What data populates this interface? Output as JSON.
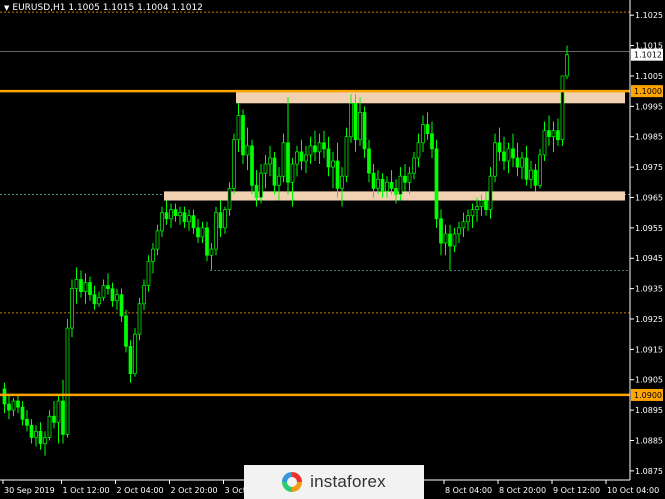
{
  "header": {
    "symbol_line": "EURUSD,H1  1.1005 1.1015 1.1004 1.1012"
  },
  "watermark": {
    "text": "instaforex"
  },
  "colors": {
    "background": "#000000",
    "candle": "#00ff00",
    "level_line": "#ffa500",
    "zone_fill": "#ffdcbd",
    "grid_dotted": "#5f9ea0",
    "grid_orange": "#ffa500",
    "axis_text": "#ffffff"
  },
  "chart_data": {
    "type": "candlestick",
    "symbol": "EURUSD",
    "timeframe": "H1",
    "last_price": 1.1012,
    "ohlc_last": {
      "open": 1.1005,
      "high": 1.1015,
      "low": 1.1004,
      "close": 1.1012
    },
    "ylim": [
      1.0872,
      1.103
    ],
    "y_ticks": [
      1.1025,
      1.1015,
      1.1005,
      1.0995,
      1.0985,
      1.0975,
      1.0965,
      1.0955,
      1.0945,
      1.0935,
      1.0925,
      1.0915,
      1.0905,
      1.0895,
      1.0885,
      1.0875
    ],
    "y_ticks_text": [
      "1.1025",
      "1.1015",
      "1.1005",
      "1.0995",
      "1.0985",
      "1.0975",
      "1.0965",
      "1.0955",
      "1.0945",
      "1.0935",
      "1.0925",
      "1.0915",
      "1.0905",
      "1.0895",
      "1.0885",
      "1.0875"
    ],
    "x_ticks": [
      "30 Sep 2019",
      "1 Oct 12:00",
      "2 Oct 04:00",
      "2 Oct 20:00",
      "3 Oct 12:00",
      "8 Oct 04:00",
      "8 Oct 20:00",
      "9 Oct 12:00",
      "10 Oct 04:00"
    ],
    "x_tick_index": [
      0,
      13,
      25,
      37,
      49,
      98,
      110,
      122,
      134
    ],
    "horizontal_levels": [
      {
        "price": 1.1,
        "label": "1.1000",
        "style": "solid-thick"
      },
      {
        "price": 1.09,
        "label": "1.0900",
        "style": "solid-thick"
      }
    ],
    "zones": [
      {
        "from_index": 52,
        "to_index": 138,
        "low": 1.0996,
        "high": 1.1
      },
      {
        "from_index": 36,
        "to_index": 138,
        "low": 1.0964,
        "high": 1.0967
      }
    ],
    "dotted_lines": [
      {
        "price": 1.1026,
        "color": "orange"
      },
      {
        "price": 1.1013,
        "color": "gray"
      },
      {
        "price": 1.0966,
        "color": "teal"
      },
      {
        "price": 1.0941,
        "color": "teal",
        "from_index": 46
      },
      {
        "price": 1.0927,
        "color": "orange"
      }
    ],
    "candles": [
      [
        1.0902,
        1.0904,
        1.0894,
        1.0897
      ],
      [
        1.0897,
        1.09,
        1.0892,
        1.0895
      ],
      [
        1.0895,
        1.0899,
        1.0893,
        1.0898
      ],
      [
        1.0898,
        1.09,
        1.0894,
        1.0896
      ],
      [
        1.0896,
        1.0898,
        1.089,
        1.0892
      ],
      [
        1.0892,
        1.0895,
        1.0888,
        1.089
      ],
      [
        1.089,
        1.0892,
        1.0884,
        1.0886
      ],
      [
        1.0886,
        1.089,
        1.0883,
        1.0888
      ],
      [
        1.0888,
        1.0891,
        1.0882,
        1.0884
      ],
      [
        1.0884,
        1.0888,
        1.088,
        1.0886
      ],
      [
        1.0886,
        1.0895,
        1.0885,
        1.0893
      ],
      [
        1.0893,
        1.0898,
        1.0889,
        1.0891
      ],
      [
        1.0891,
        1.09,
        1.0884,
        1.0898
      ],
      [
        1.0898,
        1.0905,
        1.0884,
        1.0887
      ],
      [
        1.0887,
        1.0925,
        1.0886,
        1.0922
      ],
      [
        1.0922,
        1.0938,
        1.0919,
        1.0935
      ],
      [
        1.0935,
        1.0942,
        1.093,
        1.0938
      ],
      [
        1.0938,
        1.0941,
        1.0932,
        1.0934
      ],
      [
        1.0934,
        1.094,
        1.093,
        1.0937
      ],
      [
        1.0937,
        1.0939,
        1.0931,
        1.0933
      ],
      [
        1.0933,
        1.0936,
        1.0928,
        1.093
      ],
      [
        1.093,
        1.0934,
        1.0929,
        1.0932
      ],
      [
        1.0932,
        1.0938,
        1.0931,
        1.0936
      ],
      [
        1.0936,
        1.094,
        1.0933,
        1.0935
      ],
      [
        1.0935,
        1.0937,
        1.0929,
        1.0931
      ],
      [
        1.0931,
        1.0935,
        1.0928,
        1.0933
      ],
      [
        1.0933,
        1.0935,
        1.0924,
        1.0926
      ],
      [
        1.0926,
        1.0928,
        1.0914,
        1.0916
      ],
      [
        1.0916,
        1.0918,
        1.0904,
        1.0907
      ],
      [
        1.0907,
        1.0922,
        1.0906,
        1.092
      ],
      [
        1.092,
        1.0932,
        1.0918,
        1.093
      ],
      [
        1.093,
        1.0938,
        1.0928,
        1.0936
      ],
      [
        1.0936,
        1.0946,
        1.0934,
        1.0944
      ],
      [
        1.0944,
        1.095,
        1.094,
        1.0948
      ],
      [
        1.0948,
        1.0956,
        1.0946,
        1.0954
      ],
      [
        1.0954,
        1.0962,
        1.0952,
        1.096
      ],
      [
        1.096,
        1.0964,
        1.0956,
        1.0958
      ],
      [
        1.0958,
        1.0963,
        1.0955,
        1.0961
      ],
      [
        1.0961,
        1.0963,
        1.0957,
        1.0959
      ],
      [
        1.0959,
        1.0962,
        1.0956,
        1.096
      ],
      [
        1.096,
        1.0962,
        1.0955,
        1.0957
      ],
      [
        1.0957,
        1.0961,
        1.0954,
        1.0959
      ],
      [
        1.0959,
        1.0961,
        1.0953,
        1.0955
      ],
      [
        1.0955,
        1.0958,
        1.095,
        1.0952
      ],
      [
        1.0952,
        1.0957,
        1.095,
        1.0955
      ],
      [
        1.0955,
        1.0957,
        1.0944,
        1.0946
      ],
      [
        1.0946,
        1.095,
        1.0941,
        1.0948
      ],
      [
        1.0948,
        1.0962,
        1.0946,
        1.096
      ],
      [
        1.096,
        1.0964,
        1.0952,
        1.0955
      ],
      [
        1.0955,
        1.0962,
        1.0953,
        1.0961
      ],
      [
        1.0961,
        1.097,
        1.0959,
        1.0968
      ],
      [
        1.0968,
        1.0986,
        1.0966,
        1.0984
      ],
      [
        1.0984,
        1.0996,
        1.098,
        1.0992
      ],
      [
        1.0992,
        1.0994,
        1.0976,
        1.0979
      ],
      [
        1.0979,
        1.0988,
        1.0974,
        1.0982
      ],
      [
        1.0982,
        1.0984,
        1.0966,
        1.0969
      ],
      [
        1.0969,
        1.0974,
        1.0962,
        1.0965
      ],
      [
        1.0965,
        1.0976,
        1.0963,
        1.0973
      ],
      [
        1.0973,
        1.0979,
        1.0968,
        1.0976
      ],
      [
        1.0976,
        1.0982,
        1.0972,
        1.0978
      ],
      [
        1.0978,
        1.098,
        1.0966,
        1.0969
      ],
      [
        1.0969,
        1.0975,
        1.0964,
        1.0972
      ],
      [
        1.0972,
        1.0986,
        1.097,
        1.0983
      ],
      [
        1.0983,
        1.0998,
        1.0966,
        1.097
      ],
      [
        1.097,
        1.0978,
        1.0962,
        1.0976
      ],
      [
        1.0976,
        1.0982,
        1.0972,
        1.098
      ],
      [
        1.098,
        1.0984,
        1.0974,
        1.0977
      ],
      [
        1.0977,
        1.0982,
        1.0973,
        1.0979
      ],
      [
        1.0979,
        1.0985,
        1.0976,
        1.0982
      ],
      [
        1.0982,
        1.0987,
        1.0977,
        1.098
      ],
      [
        1.098,
        1.0986,
        1.0976,
        1.0983
      ],
      [
        1.0983,
        1.0987,
        1.0978,
        1.0981
      ],
      [
        1.0981,
        1.0985,
        1.0972,
        1.0975
      ],
      [
        1.0975,
        1.098,
        1.0968,
        1.0977
      ],
      [
        1.0977,
        1.0983,
        1.0965,
        1.0968
      ],
      [
        1.0968,
        1.0975,
        1.0962,
        1.0972
      ],
      [
        1.0972,
        1.0988,
        1.097,
        1.0985
      ],
      [
        1.0985,
        1.0999,
        1.0983,
        1.0996
      ],
      [
        1.0996,
        1.0999,
        1.098,
        1.0984
      ],
      [
        1.0984,
        1.0998,
        1.0982,
        1.0993
      ],
      [
        1.0993,
        1.0995,
        1.0978,
        1.0981
      ],
      [
        1.0981,
        1.0984,
        1.097,
        1.0973
      ],
      [
        1.0973,
        1.0976,
        1.0965,
        1.0968
      ],
      [
        1.0968,
        1.0974,
        1.0966,
        1.0971
      ],
      [
        1.0971,
        1.0973,
        1.0965,
        1.0967
      ],
      [
        1.0967,
        1.0972,
        1.0965,
        1.097
      ],
      [
        1.097,
        1.0974,
        1.0966,
        1.0968
      ],
      [
        1.0968,
        1.0971,
        1.0963,
        1.0966
      ],
      [
        1.0966,
        1.0975,
        1.0964,
        1.0972
      ],
      [
        1.0972,
        1.0976,
        1.0967,
        1.097
      ],
      [
        1.097,
        1.0975,
        1.0966,
        1.0973
      ],
      [
        1.0973,
        1.098,
        1.0971,
        1.0978
      ],
      [
        1.0978,
        1.0986,
        1.0975,
        1.0983
      ],
      [
        1.0983,
        1.0992,
        1.098,
        1.0989
      ],
      [
        1.0989,
        1.0993,
        1.0984,
        1.0986
      ],
      [
        1.0986,
        1.099,
        1.0978,
        1.0981
      ],
      [
        1.0981,
        1.0984,
        1.0955,
        1.0958
      ],
      [
        1.0958,
        1.0961,
        1.0946,
        1.095
      ],
      [
        1.095,
        1.0956,
        1.0946,
        1.0953
      ],
      [
        1.0953,
        1.0956,
        1.0941,
        1.0949
      ],
      [
        1.0949,
        1.0955,
        1.0947,
        1.0953
      ],
      [
        1.0953,
        1.0957,
        1.095,
        1.0955
      ],
      [
        1.0955,
        1.096,
        1.0952,
        1.0957
      ],
      [
        1.0957,
        1.0961,
        1.0954,
        1.0959
      ],
      [
        1.0959,
        1.0963,
        1.0955,
        1.0961
      ],
      [
        1.0961,
        1.0965,
        1.0957,
        1.0962
      ],
      [
        1.0962,
        1.0966,
        1.0959,
        1.0964
      ],
      [
        1.0964,
        1.0967,
        1.0959,
        1.0961
      ],
      [
        1.0961,
        1.0975,
        1.0958,
        1.0972
      ],
      [
        1.0972,
        1.0986,
        1.097,
        1.0983
      ],
      [
        1.0983,
        1.0988,
        1.0977,
        1.098
      ],
      [
        1.098,
        1.0985,
        1.0974,
        1.0977
      ],
      [
        1.0977,
        1.0983,
        1.0973,
        1.0981
      ],
      [
        1.0981,
        1.0986,
        1.0975,
        1.0978
      ],
      [
        1.0978,
        1.0983,
        1.0972,
        1.0975
      ],
      [
        1.0975,
        1.098,
        1.0971,
        1.0978
      ],
      [
        1.0978,
        1.0982,
        1.0969,
        1.0971
      ],
      [
        1.0971,
        1.0977,
        1.0968,
        1.0974
      ],
      [
        1.0974,
        1.0976,
        1.0967,
        1.0969
      ],
      [
        1.0969,
        1.0981,
        1.0968,
        1.0979
      ],
      [
        1.0979,
        1.099,
        1.0977,
        1.0987
      ],
      [
        1.0987,
        1.0992,
        1.0982,
        1.0985
      ],
      [
        1.0985,
        1.099,
        1.098,
        1.0987
      ],
      [
        1.0987,
        1.0991,
        1.0982,
        1.0984
      ],
      [
        1.0984,
        1.1005,
        1.0982,
        1.1005
      ],
      [
        1.1005,
        1.1015,
        1.1004,
        1.1012
      ]
    ]
  }
}
